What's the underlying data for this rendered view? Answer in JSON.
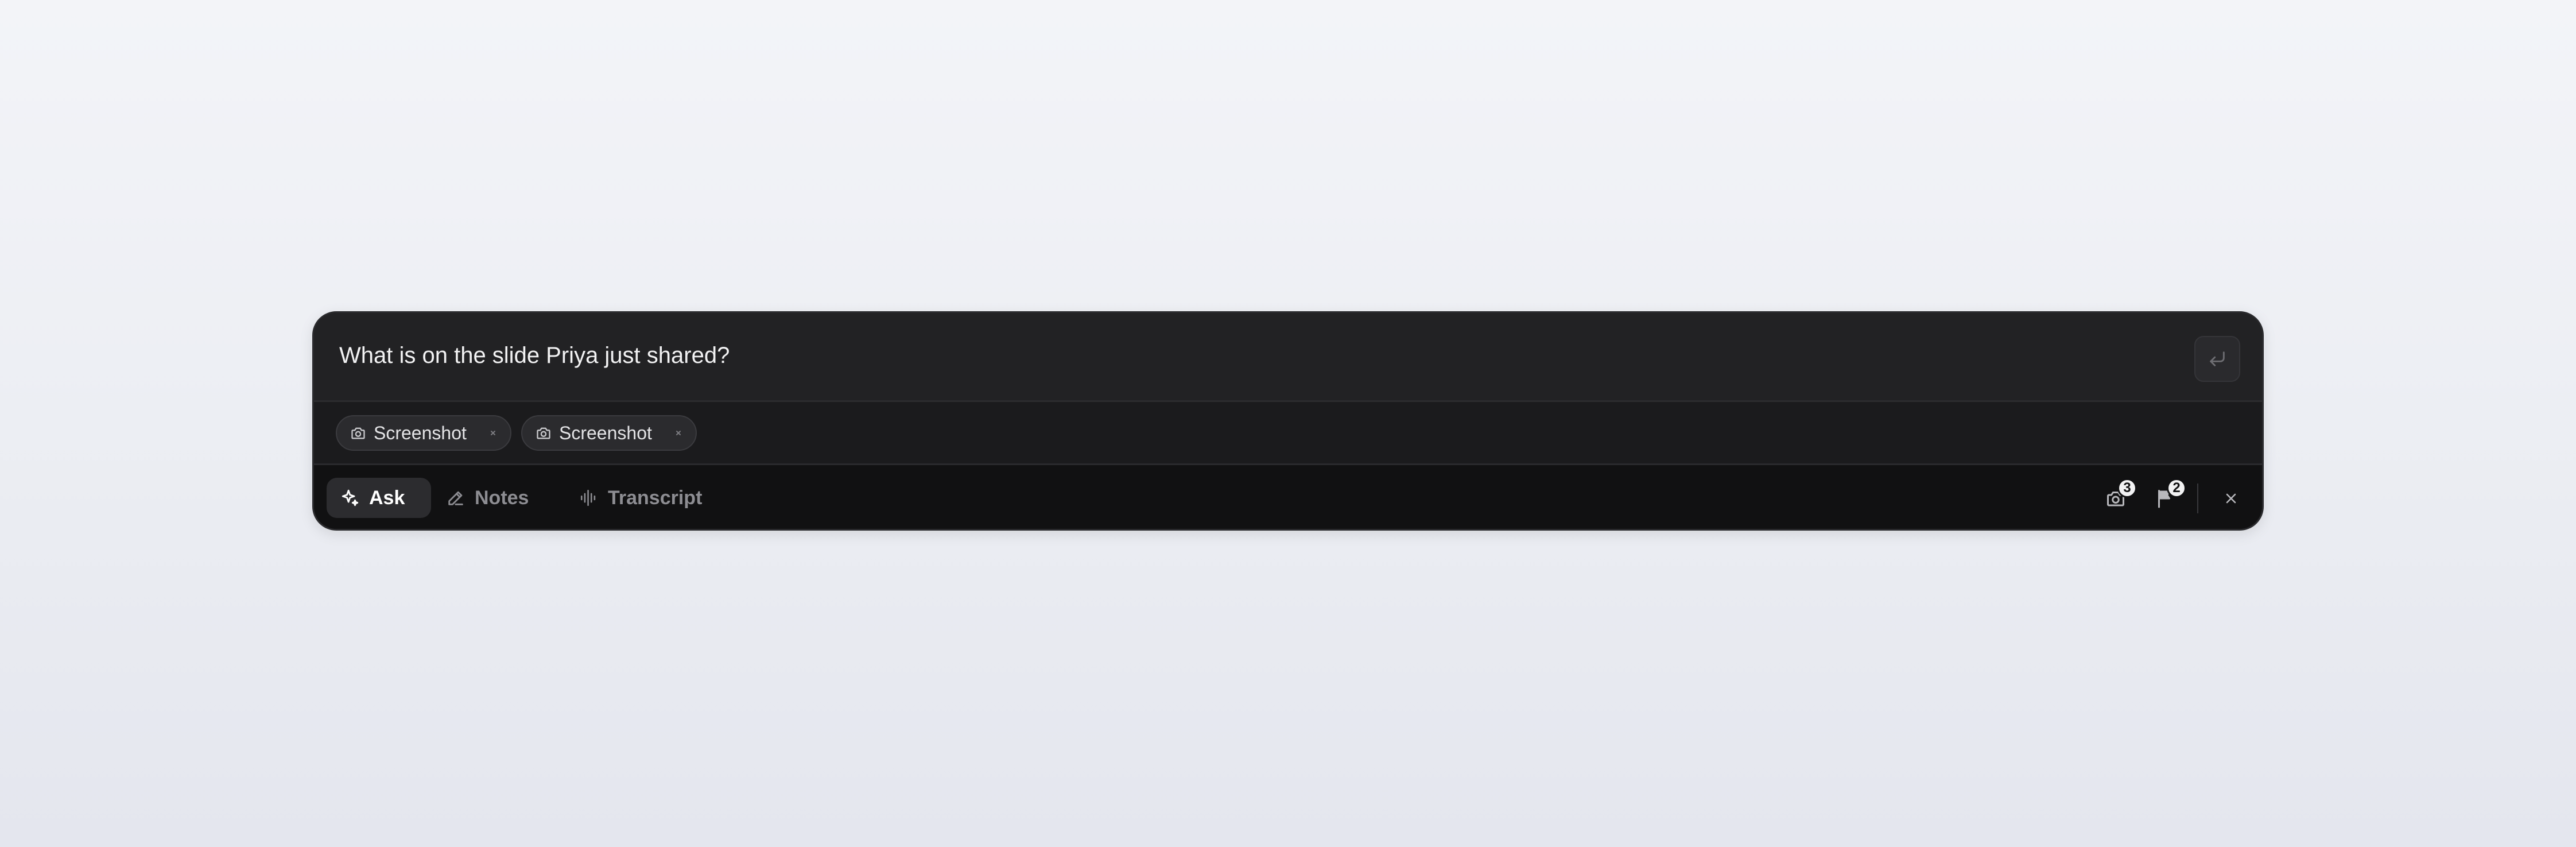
{
  "query": {
    "text": "What is on the slide Priya just shared?",
    "send_icon": "return-icon"
  },
  "attachments": [
    {
      "label": "Screenshot",
      "icon": "camera-icon",
      "remove_icon": "close-icon"
    },
    {
      "label": "Screenshot",
      "icon": "camera-icon",
      "remove_icon": "close-icon"
    }
  ],
  "tabs": [
    {
      "label": "Ask",
      "icon": "sparkles-icon",
      "active": true
    },
    {
      "label": "Notes",
      "icon": "pencil-icon",
      "active": false
    },
    {
      "label": "Transcript",
      "icon": "audio-waveform-icon",
      "active": false
    }
  ],
  "tools": {
    "screenshots_count": "3",
    "flags_count": "2",
    "close_icon": "close-icon"
  },
  "colors": {
    "panel_bg": "#121213",
    "query_bg": "#222224",
    "active_tab_bg": "#2c2c2f",
    "text_primary": "#f2f2f3",
    "text_muted": "#8d8d92"
  }
}
